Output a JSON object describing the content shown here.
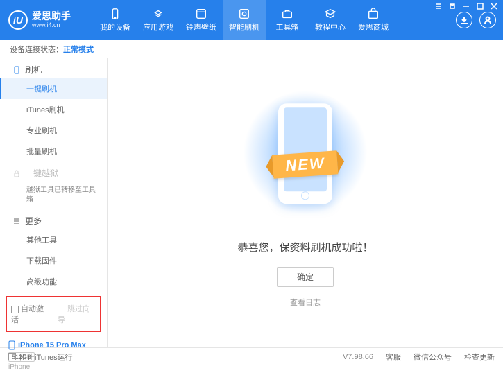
{
  "app": {
    "title": "爱思助手",
    "subtitle": "www.i4.cn",
    "logo_letter": "iU"
  },
  "nav": {
    "items": [
      {
        "label": "我的设备"
      },
      {
        "label": "应用游戏"
      },
      {
        "label": "铃声壁纸"
      },
      {
        "label": "智能刷机"
      },
      {
        "label": "工具箱"
      },
      {
        "label": "教程中心"
      },
      {
        "label": "爱思商城"
      }
    ]
  },
  "status": {
    "label": "设备连接状态：",
    "value": "正常模式"
  },
  "sidebar": {
    "section_flash": "刷机",
    "items_flash": [
      "一键刷机",
      "iTunes刷机",
      "专业刷机",
      "批量刷机"
    ],
    "section_jail": "一键越狱",
    "jail_info": "越狱工具已转移至工具箱",
    "section_more": "更多",
    "items_more": [
      "其他工具",
      "下载固件",
      "高级功能"
    ]
  },
  "options": {
    "auto_activate": "自动激活",
    "skip_guide": "跳过向导"
  },
  "device": {
    "name": "iPhone 15 Pro Max",
    "storage": "512GB",
    "type": "iPhone"
  },
  "main": {
    "banner": "NEW",
    "success": "恭喜您，保资料刷机成功啦！",
    "ok": "确定",
    "view_log": "查看日志"
  },
  "footer": {
    "block_itunes": "阻止iTunes运行",
    "version": "V7.98.66",
    "support": "客服",
    "wechat": "微信公众号",
    "update": "检查更新"
  }
}
